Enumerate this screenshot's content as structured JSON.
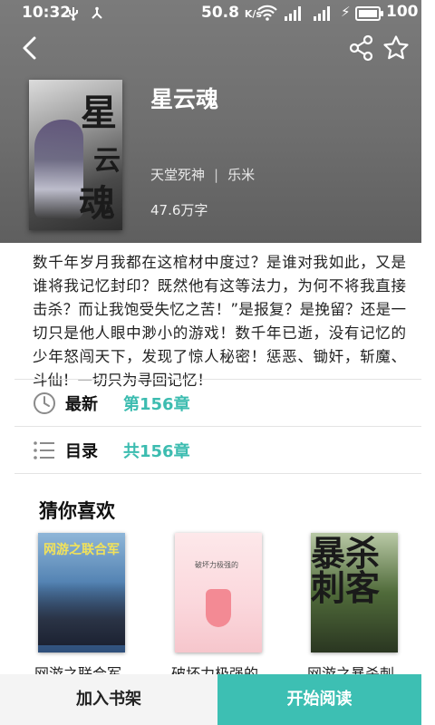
{
  "status_bar": {
    "time": "10:32",
    "left_icons": [
      "usb-icon",
      "debug-icon"
    ],
    "speed_value": "50.8",
    "speed_unit": "K/s",
    "battery_level": 1.0,
    "battery_text": "100"
  },
  "header": {
    "back_icon": "back-arrow-icon",
    "share_icon": "share-icon",
    "favorite_icon": "star-icon"
  },
  "book": {
    "cover_text": [
      "星",
      "云",
      "魂"
    ],
    "title": "星云魂",
    "author": "天堂死神",
    "separator": "|",
    "category": "乐米",
    "word_count": "47.6万字",
    "description": "数千年岁月我都在这棺材中度过？是谁对我如此，又是谁将我记忆封印？既然他有这等法力，为何不将我直接击杀？而让我饱受失忆之苦！”是报复？是挽留？还是一切只是他人眼中渺小的游戏！数千年已逝，没有记忆的少年怒闯天下，发现了惊人秘密！惩恶、锄奸，斩魔、斗仙！一切只为寻回记忆！"
  },
  "latest": {
    "icon": "clock-icon",
    "label": "最新",
    "value": "第156章"
  },
  "toc": {
    "icon": "list-icon",
    "label": "目录",
    "value": "共156章"
  },
  "recommend": {
    "title": "猜你喜欢",
    "items": [
      {
        "name": "网游之联合军",
        "cover_text": "网游之联合军"
      },
      {
        "name": "破坏力极强的",
        "cover_text": "破坏力极强的"
      },
      {
        "name": "网游之暴杀刺",
        "cover_text": "暴杀刺客"
      }
    ]
  },
  "actions": {
    "add_shelf": "加入书架",
    "start_read": "开始阅读"
  },
  "colors": {
    "accent": "#3dbfb3",
    "hero_bg": "#6e6e6e"
  }
}
